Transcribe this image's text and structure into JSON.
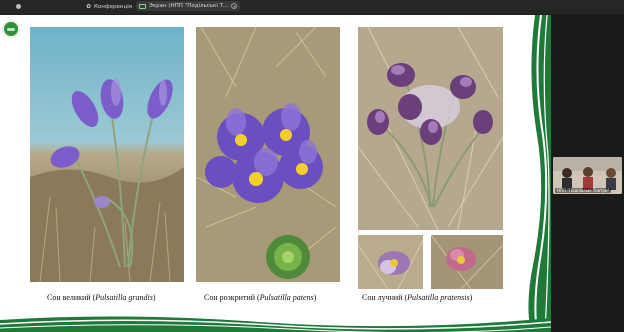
{
  "tabs": [
    {
      "label": ""
    },
    {
      "label": "Конференція"
    },
    {
      "label": "Экран (НПП \"Подільські Т..."
    }
  ],
  "slide": {
    "captions": [
      {
        "prefix": "Сон великий (",
        "latin": "Pulsatilla grandis",
        "suffix": ")"
      },
      {
        "prefix": "Сон розкритий (",
        "latin": "Pulsatilla patens",
        "suffix": ")"
      },
      {
        "prefix": "Сон лучний (",
        "latin": "Pulsatilla pratensis",
        "suffix": ")"
      }
    ]
  },
  "video": {
    "label": "НПП \"Подільські Товтри\""
  },
  "colors": {
    "accent_green": "#1f7a3a",
    "flower_purple": "#7b5ec9"
  }
}
